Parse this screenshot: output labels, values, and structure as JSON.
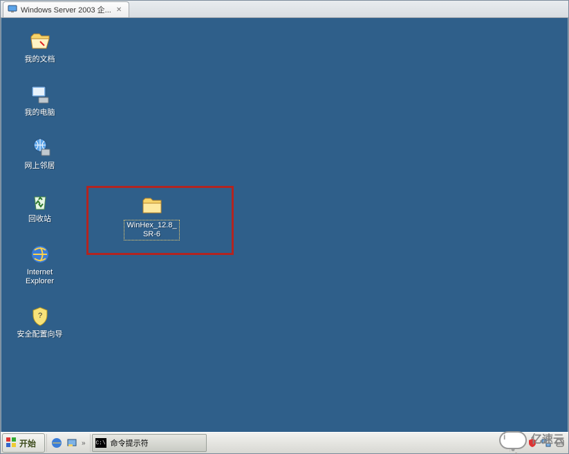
{
  "tab": {
    "title": "Windows Server 2003 企..."
  },
  "desktop": {
    "icons": {
      "documents": {
        "label": "我的文档"
      },
      "computer": {
        "label": "我的电脑"
      },
      "network": {
        "label": "网上邻居"
      },
      "recycle": {
        "label": "回收站"
      },
      "ie": {
        "label": "Internet\nExplorer"
      },
      "security": {
        "label": "安全配置向导"
      },
      "winhex": {
        "label": "WinHex_12.8_\nSR-6"
      }
    }
  },
  "taskbar": {
    "start": "开始",
    "cmd_label": "命令提示符"
  },
  "watermark": "亿速云"
}
